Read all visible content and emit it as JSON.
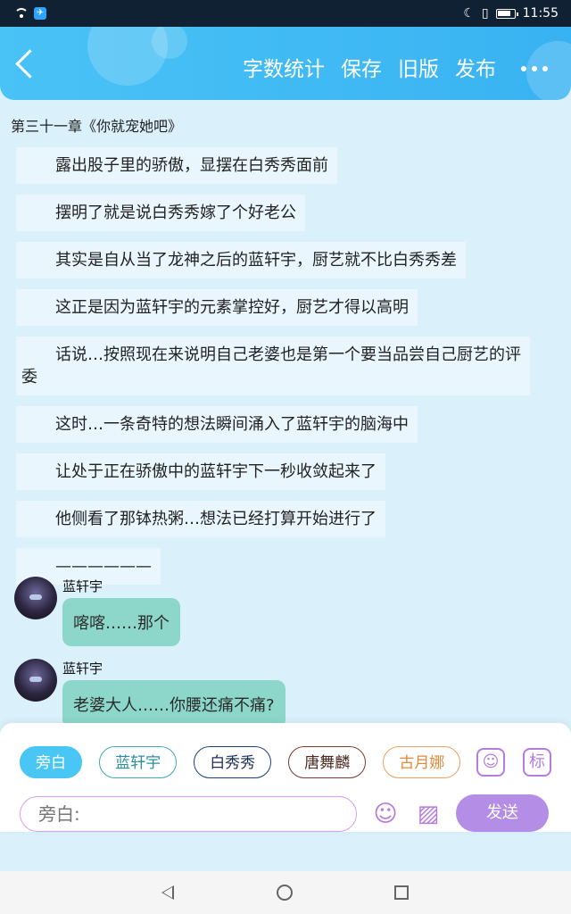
{
  "status_bar": {
    "time": "11:55",
    "app_icon": "app-badge"
  },
  "header": {
    "actions": [
      "字数统计",
      "保存",
      "旧版",
      "发布"
    ],
    "colors": {
      "accent": "#3fb9f4"
    }
  },
  "chapter_title": "第三十一章《你就宠她吧》",
  "narrations": [
    "露出股子里的骄傲，显摆在白秀秀面前",
    "摆明了就是说白秀秀嫁了个好老公",
    "其实是自从当了龙神之后的蓝轩宇，厨艺就不比白秀秀差",
    "这正是因为蓝轩宇的元素掌控好，厨艺才得以高明",
    "话说…按照现在来说明自己老婆也是第一个要当品尝自己厨艺的评委",
    "这时…一条奇特的想法瞬间涌入了蓝轩宇的脑海中",
    "让处于正在骄傲中的蓝轩宇下一秒收敛起来了",
    "他侧看了那钵热粥…想法已经打算开始进行了",
    "——————"
  ],
  "messages": [
    {
      "speaker": "蓝轩宇",
      "text": "喀喀……那个"
    },
    {
      "speaker": "蓝轩宇",
      "text": "老婆大人……你腰还痛不痛?"
    }
  ],
  "character_chips": [
    "旁白",
    "蓝轩宇",
    "白秀秀",
    "唐舞麟",
    "古月娜"
  ],
  "panel_icons": {
    "character": "person-icon",
    "tag": "标"
  },
  "input": {
    "placeholder": "旁白:"
  },
  "send_label": "发送"
}
